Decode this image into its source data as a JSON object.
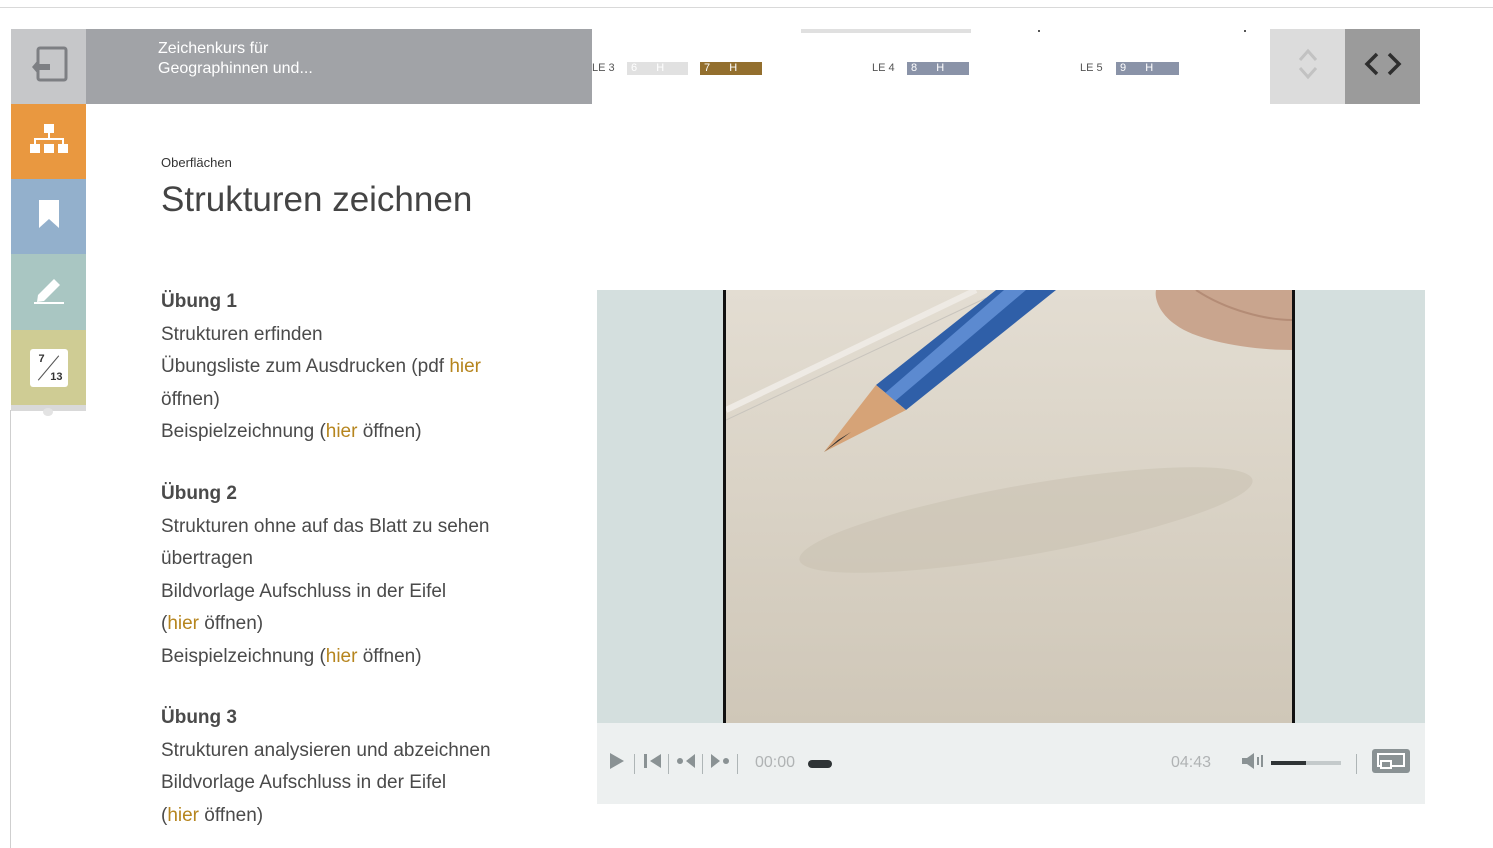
{
  "header": {
    "course_title_line1": "Zeichenkurs für",
    "course_title_line2": "Geographinnen und...",
    "timeline": [
      {
        "le_label": "LE 3",
        "hours": [
          {
            "num": "6",
            "unit": "H",
            "color": "#e1e1e1"
          },
          {
            "num": "7",
            "unit": "H",
            "color": "#936f2e"
          }
        ]
      },
      {
        "le_label": "LE 4",
        "hours": [
          {
            "num": "8",
            "unit": "H",
            "color": "#8a93a8"
          }
        ]
      },
      {
        "le_label": "LE 5",
        "hours": [
          {
            "num": "9",
            "unit": "H",
            "color": "#8a93a8"
          }
        ]
      }
    ]
  },
  "sidebar": {
    "items": [
      {
        "name": "back",
        "icon": "back-icon",
        "color": "#c6c7c9"
      },
      {
        "name": "structure",
        "icon": "sitemap-icon",
        "color": "#e99840"
      },
      {
        "name": "bookmark",
        "icon": "bookmark-icon",
        "color": "#93b0cc"
      },
      {
        "name": "notes",
        "icon": "pencil-icon",
        "color": "#a9c6c2"
      },
      {
        "name": "pages",
        "icon": "page-counter-icon",
        "color": "#cfcc94"
      }
    ],
    "page_current": "7",
    "page_total": "13"
  },
  "content": {
    "breadcrumb": "Oberflächen",
    "title": "Strukturen zeichnen",
    "ex1": {
      "heading": "Übung 1",
      "l1": "Strukturen erfinden",
      "l2_pre": "Übungsliste zum Ausdrucken (pdf ",
      "l2_link": "hier",
      "l3": "öffnen)",
      "l4_pre": "Beispielzeichnung (",
      "l4_link": "hier",
      "l4_post": " öffnen)"
    },
    "ex2": {
      "heading": "Übung 2",
      "l1": "Strukturen ohne auf das Blatt zu sehen",
      "l2": "übertragen",
      "l3": "Bildvorlage Aufschluss in der Eifel",
      "l4_pre": "(",
      "l4_link": "hier",
      "l4_post": " öffnen)",
      "l5_pre": "Beispielzeichnung (",
      "l5_link": "hier",
      "l5_post": " öffnen)"
    },
    "ex3": {
      "heading": "Übung 3",
      "l1": "Strukturen analysieren und abzeichnen",
      "l2": "Bildvorlage Aufschluss in der Eifel",
      "l3_pre": "(",
      "l3_link": "hier",
      "l3_post": " öffnen)"
    }
  },
  "video": {
    "current_time": "00:00",
    "duration": "04:43",
    "progress": 0,
    "volume": 0.5
  },
  "colors": {
    "link": "#b6851e"
  }
}
